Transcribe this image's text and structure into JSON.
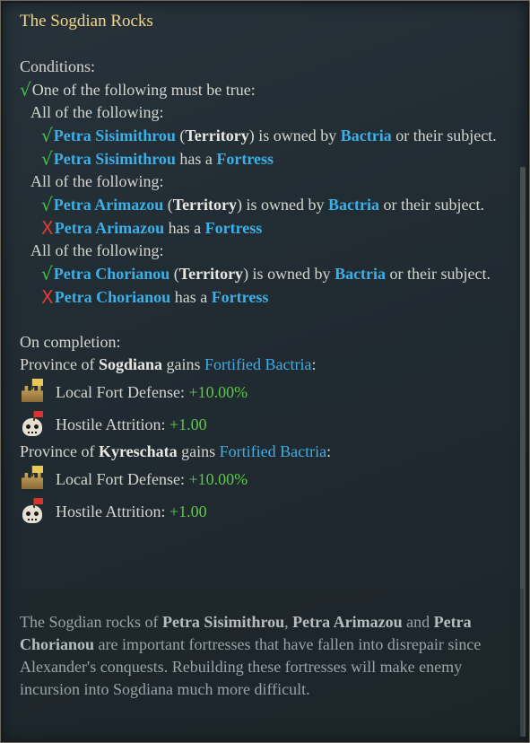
{
  "title": "The Sogdian Rocks",
  "conditions": {
    "header": "Conditions:",
    "root": "One of the following must be true:",
    "groups": [
      {
        "label": "All of the following:",
        "owned": {
          "place": "Petra Sisimithrou",
          "type": "Territory",
          "pre": "(",
          "post": ") is owned by",
          "owner": "Bactria",
          "tail": "or their subject."
        },
        "has": {
          "place": "Petra Sisimithrou",
          "text": "has a",
          "building": "Fortress"
        }
      },
      {
        "label": "All of the following:",
        "owned": {
          "place": "Petra Arimazou",
          "type": "Territory",
          "pre": "(",
          "post": ") is owned by",
          "owner": "Bactria",
          "tail": "or their subject."
        },
        "has": {
          "place": "Petra Arimazou",
          "text": "has a",
          "building": "Fortress"
        }
      },
      {
        "label": "All of the following:",
        "owned": {
          "place": "Petra Chorianou",
          "type": "Territory",
          "pre": "(",
          "post": ") is owned by",
          "owner": "Bactria",
          "tail": "or their subject."
        },
        "has": {
          "place": "Petra Chorianou",
          "text": "has a",
          "building": "Fortress"
        }
      }
    ]
  },
  "completion": {
    "header": "On completion:",
    "provinces": [
      {
        "prefix": "Province of",
        "name": "Sogdiana",
        "verb": "gains",
        "modifier": "Fortified Bactria",
        "colon": ":",
        "effects": [
          {
            "icon": "fort-icon",
            "label": "Local Fort Defense:",
            "value": "+10.00%"
          },
          {
            "icon": "skull-icon",
            "label": "Hostile Attrition:",
            "value": "+1.00"
          }
        ]
      },
      {
        "prefix": "Province of",
        "name": "Kyreschata",
        "verb": "gains",
        "modifier": "Fortified Bactria",
        "colon": ":",
        "effects": [
          {
            "icon": "fort-icon",
            "label": "Local Fort Defense:",
            "value": "+10.00%"
          },
          {
            "icon": "skull-icon",
            "label": "Hostile Attrition:",
            "value": "+1.00"
          }
        ]
      }
    ]
  },
  "description": {
    "t1": "The Sogdian rocks of",
    "p1": "Petra Sisimithrou",
    "t2": ",",
    "p2": "Petra Arimazou",
    "t3": "and",
    "p3": "Petra Chorianou",
    "t4": "are important fortresses that have fallen into disrepair since Alexander's conquests. Rebuilding these fortresses will make enemy incursion into Sogdiana much more difficult."
  },
  "colors": {
    "title": "#f0d58a",
    "link": "#3ab0e8",
    "positive": "#5cc84a",
    "check": "#3ec34a",
    "cross": "#e23a2e"
  }
}
